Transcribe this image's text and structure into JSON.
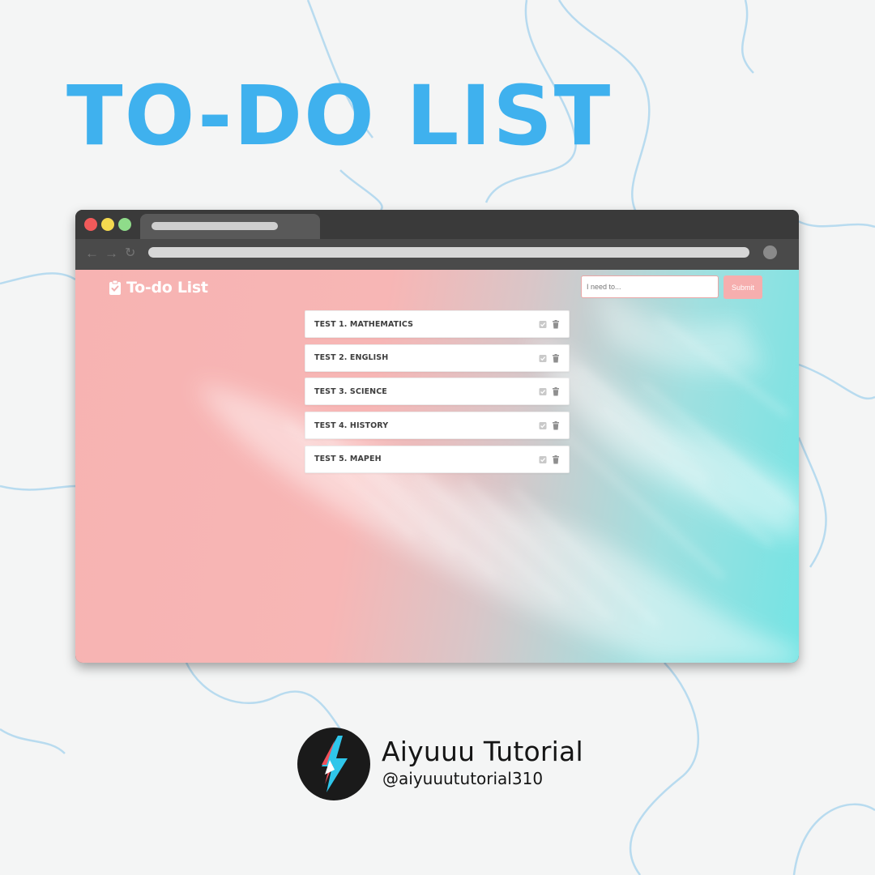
{
  "headline": "TO-DO LIST",
  "app": {
    "title": "To-do List",
    "input": {
      "value": "",
      "placeholder": "I need to..."
    },
    "submit_label": "Submit",
    "tasks": [
      {
        "label": "TEST 1. MATHEMATICS"
      },
      {
        "label": "TEST 2. ENGLISH"
      },
      {
        "label": "TEST 3. SCIENCE"
      },
      {
        "label": "TEST 4. HISTORY"
      },
      {
        "label": "TEST 5. MAPEH"
      }
    ]
  },
  "footer": {
    "name": "Aiyuuu Tutorial",
    "handle": "@aiyuuututorial310"
  },
  "colors": {
    "headline": "#3fb1ee",
    "submit": "#f6aeae",
    "gradient_left": "#f7b3b2",
    "gradient_right": "#74e4e4"
  },
  "icons": [
    "clipboard-check-icon",
    "check-square-icon",
    "trash-icon",
    "back-arrow-icon",
    "forward-arrow-icon",
    "reload-icon",
    "lightning-logo-icon"
  ]
}
